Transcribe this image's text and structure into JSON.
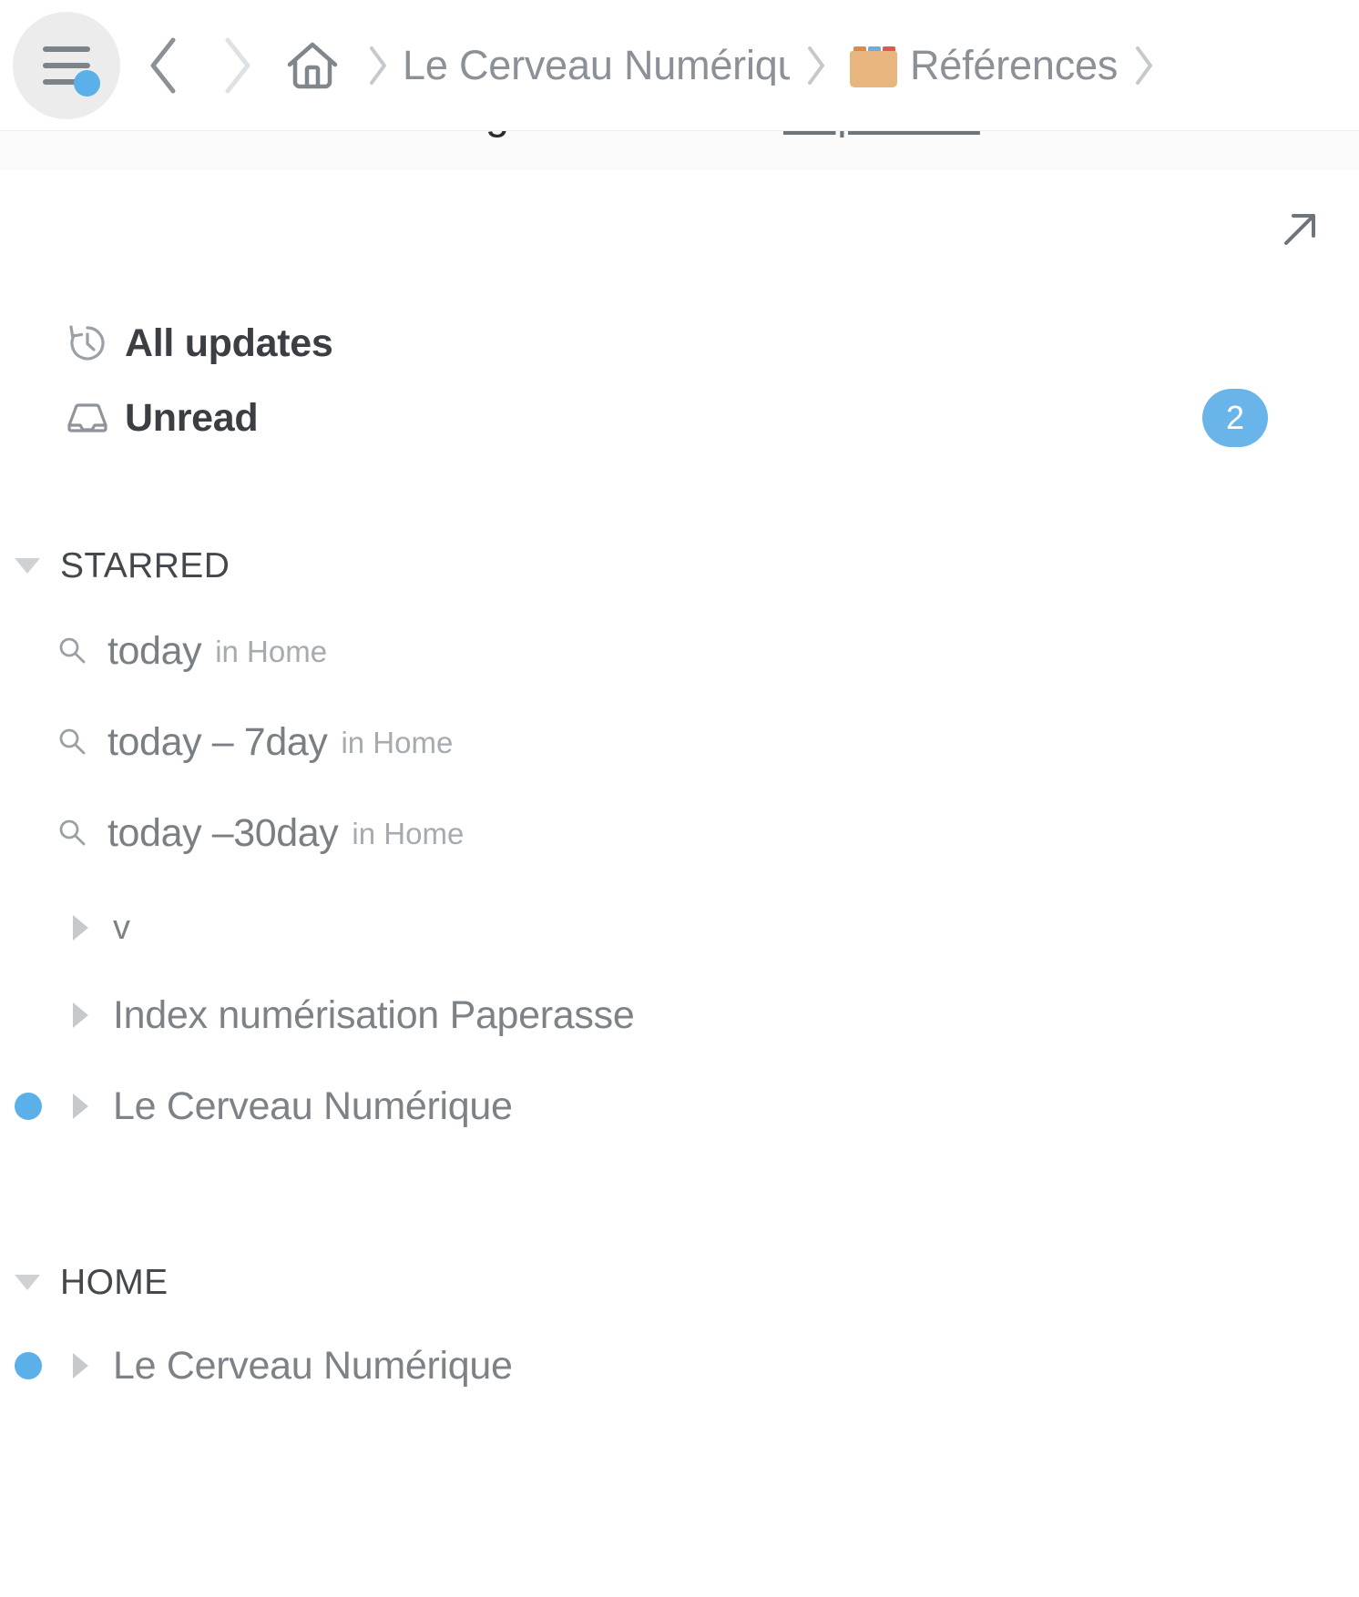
{
  "toolbar": {
    "menu_button": "menu",
    "back_label": "Back",
    "forward_label": "Forward",
    "home_label": "Home",
    "breadcrumbs": [
      {
        "label": "Le Cerveau Numérique",
        "emoji": ""
      },
      {
        "label": "Références",
        "emoji": "card-index-dividers"
      }
    ]
  },
  "cut_off_text": {
    "bullet": "•",
    "before": "Enregistrez-vous en ",
    "link": "cliquant ici",
    "after": "."
  },
  "panel": {
    "expand_icon": "arrow-up-right-icon",
    "quick_links": [
      {
        "icon": "history-clock-icon",
        "label": "All updates",
        "badge": ""
      },
      {
        "icon": "inbox-icon",
        "label": "Unread",
        "badge": "2"
      }
    ],
    "sections": [
      {
        "title": "STARRED",
        "expanded": true,
        "searches": [
          {
            "icon": "search-icon",
            "query": "today",
            "scope": "in Home"
          },
          {
            "icon": "search-icon",
            "query": "today – 7day",
            "scope": "in Home"
          },
          {
            "icon": "search-icon",
            "query": "today –30day",
            "scope": "in Home"
          }
        ],
        "items": [
          {
            "label": "v",
            "unread": false,
            "expanded": false,
            "small": true
          },
          {
            "label": "Index numérisation Paperasse",
            "unread": false,
            "expanded": false,
            "small": false
          },
          {
            "label": "Le Cerveau Numérique",
            "unread": true,
            "expanded": false,
            "small": false
          }
        ]
      },
      {
        "title": "HOME",
        "expanded": true,
        "searches": [],
        "items": [
          {
            "label": "Le Cerveau Numérique",
            "unread": true,
            "expanded": false,
            "small": false
          }
        ]
      }
    ]
  },
  "colors": {
    "accent_blue": "#5cb0ea",
    "badge_blue": "#69b5ea",
    "text_dark": "#3b3f44",
    "text_muted": "#7d8287",
    "text_faint": "#a6abaf"
  }
}
